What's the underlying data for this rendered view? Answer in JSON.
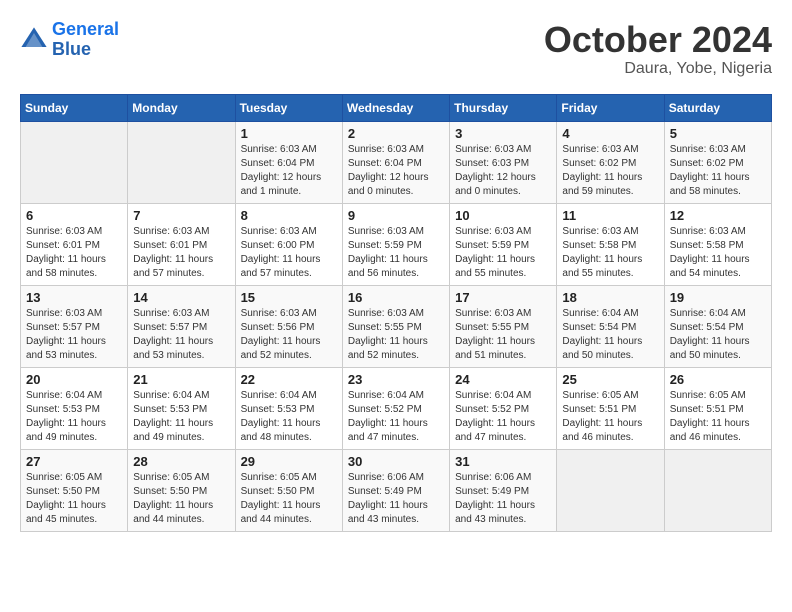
{
  "header": {
    "logo_line1": "General",
    "logo_line2": "Blue",
    "title": "October 2024",
    "subtitle": "Daura, Yobe, Nigeria"
  },
  "calendar": {
    "days_of_week": [
      "Sunday",
      "Monday",
      "Tuesday",
      "Wednesday",
      "Thursday",
      "Friday",
      "Saturday"
    ],
    "weeks": [
      [
        {
          "day": "",
          "info": ""
        },
        {
          "day": "",
          "info": ""
        },
        {
          "day": "1",
          "info": "Sunrise: 6:03 AM\nSunset: 6:04 PM\nDaylight: 12 hours\nand 1 minute."
        },
        {
          "day": "2",
          "info": "Sunrise: 6:03 AM\nSunset: 6:04 PM\nDaylight: 12 hours\nand 0 minutes."
        },
        {
          "day": "3",
          "info": "Sunrise: 6:03 AM\nSunset: 6:03 PM\nDaylight: 12 hours\nand 0 minutes."
        },
        {
          "day": "4",
          "info": "Sunrise: 6:03 AM\nSunset: 6:02 PM\nDaylight: 11 hours\nand 59 minutes."
        },
        {
          "day": "5",
          "info": "Sunrise: 6:03 AM\nSunset: 6:02 PM\nDaylight: 11 hours\nand 58 minutes."
        }
      ],
      [
        {
          "day": "6",
          "info": "Sunrise: 6:03 AM\nSunset: 6:01 PM\nDaylight: 11 hours\nand 58 minutes."
        },
        {
          "day": "7",
          "info": "Sunrise: 6:03 AM\nSunset: 6:01 PM\nDaylight: 11 hours\nand 57 minutes."
        },
        {
          "day": "8",
          "info": "Sunrise: 6:03 AM\nSunset: 6:00 PM\nDaylight: 11 hours\nand 57 minutes."
        },
        {
          "day": "9",
          "info": "Sunrise: 6:03 AM\nSunset: 5:59 PM\nDaylight: 11 hours\nand 56 minutes."
        },
        {
          "day": "10",
          "info": "Sunrise: 6:03 AM\nSunset: 5:59 PM\nDaylight: 11 hours\nand 55 minutes."
        },
        {
          "day": "11",
          "info": "Sunrise: 6:03 AM\nSunset: 5:58 PM\nDaylight: 11 hours\nand 55 minutes."
        },
        {
          "day": "12",
          "info": "Sunrise: 6:03 AM\nSunset: 5:58 PM\nDaylight: 11 hours\nand 54 minutes."
        }
      ],
      [
        {
          "day": "13",
          "info": "Sunrise: 6:03 AM\nSunset: 5:57 PM\nDaylight: 11 hours\nand 53 minutes."
        },
        {
          "day": "14",
          "info": "Sunrise: 6:03 AM\nSunset: 5:57 PM\nDaylight: 11 hours\nand 53 minutes."
        },
        {
          "day": "15",
          "info": "Sunrise: 6:03 AM\nSunset: 5:56 PM\nDaylight: 11 hours\nand 52 minutes."
        },
        {
          "day": "16",
          "info": "Sunrise: 6:03 AM\nSunset: 5:55 PM\nDaylight: 11 hours\nand 52 minutes."
        },
        {
          "day": "17",
          "info": "Sunrise: 6:03 AM\nSunset: 5:55 PM\nDaylight: 11 hours\nand 51 minutes."
        },
        {
          "day": "18",
          "info": "Sunrise: 6:04 AM\nSunset: 5:54 PM\nDaylight: 11 hours\nand 50 minutes."
        },
        {
          "day": "19",
          "info": "Sunrise: 6:04 AM\nSunset: 5:54 PM\nDaylight: 11 hours\nand 50 minutes."
        }
      ],
      [
        {
          "day": "20",
          "info": "Sunrise: 6:04 AM\nSunset: 5:53 PM\nDaylight: 11 hours\nand 49 minutes."
        },
        {
          "day": "21",
          "info": "Sunrise: 6:04 AM\nSunset: 5:53 PM\nDaylight: 11 hours\nand 49 minutes."
        },
        {
          "day": "22",
          "info": "Sunrise: 6:04 AM\nSunset: 5:53 PM\nDaylight: 11 hours\nand 48 minutes."
        },
        {
          "day": "23",
          "info": "Sunrise: 6:04 AM\nSunset: 5:52 PM\nDaylight: 11 hours\nand 47 minutes."
        },
        {
          "day": "24",
          "info": "Sunrise: 6:04 AM\nSunset: 5:52 PM\nDaylight: 11 hours\nand 47 minutes."
        },
        {
          "day": "25",
          "info": "Sunrise: 6:05 AM\nSunset: 5:51 PM\nDaylight: 11 hours\nand 46 minutes."
        },
        {
          "day": "26",
          "info": "Sunrise: 6:05 AM\nSunset: 5:51 PM\nDaylight: 11 hours\nand 46 minutes."
        }
      ],
      [
        {
          "day": "27",
          "info": "Sunrise: 6:05 AM\nSunset: 5:50 PM\nDaylight: 11 hours\nand 45 minutes."
        },
        {
          "day": "28",
          "info": "Sunrise: 6:05 AM\nSunset: 5:50 PM\nDaylight: 11 hours\nand 44 minutes."
        },
        {
          "day": "29",
          "info": "Sunrise: 6:05 AM\nSunset: 5:50 PM\nDaylight: 11 hours\nand 44 minutes."
        },
        {
          "day": "30",
          "info": "Sunrise: 6:06 AM\nSunset: 5:49 PM\nDaylight: 11 hours\nand 43 minutes."
        },
        {
          "day": "31",
          "info": "Sunrise: 6:06 AM\nSunset: 5:49 PM\nDaylight: 11 hours\nand 43 minutes."
        },
        {
          "day": "",
          "info": ""
        },
        {
          "day": "",
          "info": ""
        }
      ]
    ]
  }
}
